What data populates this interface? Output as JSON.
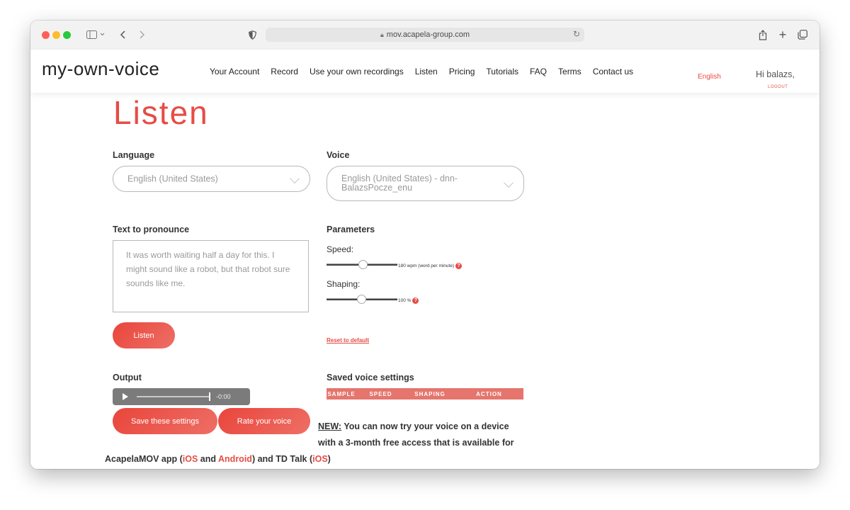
{
  "browser": {
    "url": "mov.acapela-group.com",
    "icons": {
      "sidebar": "sidebar-icon",
      "back": "chevron-left-icon",
      "forward": "chevron-right-icon",
      "shield": "shield-icon",
      "lock": "lock-icon",
      "reload": "reload-icon",
      "share": "share-icon",
      "new_tab": "plus-icon",
      "tabs": "tabs-overview-icon"
    }
  },
  "header": {
    "logo": "my-own-voice",
    "nav": [
      "Your Account",
      "Record",
      "Use your own recordings",
      "Listen",
      "Pricing",
      "Tutorials",
      "FAQ",
      "Terms",
      "Contact us"
    ],
    "language": "English",
    "greeting": "Hi balazs,",
    "logout": "LOGOUT"
  },
  "main": {
    "title": "Listen",
    "language_label": "Language",
    "language_value": "English (United States)",
    "voice_label": "Voice",
    "voice_value": "English (United States) - dnn-BalazsPocze_enu",
    "text_label": "Text to pronounce",
    "text_value": "It was worth waiting half a day for this. I might sound like a robot, but that robot sure sounds like me.",
    "listen_button": "Listen",
    "parameters_label": "Parameters",
    "speed_label": "Speed:",
    "speed_value": "180 wpm (word per minute)",
    "speed_level": 0.5,
    "shaping_label": "Shaping:",
    "shaping_value": "100 %",
    "shaping_level": 0.5,
    "reset_link": "Reset to default",
    "output_label": "Output",
    "player_time": "-0:00",
    "save_button": "Save these settings",
    "rate_button": "Rate your voice",
    "saved_label": "Saved voice settings",
    "saved_columns": [
      "SAMPLE",
      "SPEED",
      "SHAPING",
      "ACTION"
    ],
    "news_prefix": "NEW:",
    "news_line1_rest": " You can now try your voice on a device",
    "news_line2": "with a 3-month free access that is available for",
    "news_line3_a": "AcapelaMOV app (",
    "news_ios1": "iOS",
    "news_and": " and ",
    "news_android": "Android",
    "news_line3_b": ") and TD Talk (",
    "news_ios2": "iOS",
    "news_close": ")"
  },
  "colors": {
    "accent": "#e64c45",
    "table_header": "#e5756d"
  }
}
